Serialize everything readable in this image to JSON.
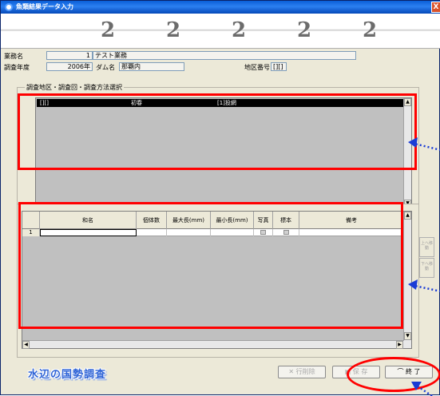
{
  "window": {
    "title": "魚類結果データ入力",
    "close_glyph": "X"
  },
  "binder": {
    "ring_glyph": "2"
  },
  "header": {
    "business_label": "業務名",
    "business_no": "1",
    "business_name": "テスト業務",
    "year_label": "調査年度",
    "year_value": "2006年",
    "dam_label": "ダム名",
    "dam_value": "那覇内",
    "area_label": "地区番号",
    "area_value": "[][]"
  },
  "survey_list": {
    "caption": "調査地区・調査回・調査方法選択",
    "selected_row": {
      "area": "[][]",
      "round": "初春",
      "method": "[1]投網"
    }
  },
  "grid": {
    "row_number": "1",
    "columns": [
      "和名",
      "個体数",
      "最大長(mm)",
      "最小長(mm)",
      "写真",
      "標本",
      "備考"
    ]
  },
  "side_buttons": {
    "move_up": "上へ移動",
    "move_down": "下へ移動"
  },
  "footer": {
    "logo_text": "水辺の国勢調査",
    "delete_label": "行削除",
    "delete_glyph": "✕",
    "save_label": "保 存",
    "save_glyph": "▣",
    "exit_label": "終 了",
    "exit_glyph": "⌒"
  },
  "colors": {
    "annotation_red": "#ff0000",
    "arrow_blue": "#1a3cd6",
    "logo_blue": "#2d62d6",
    "title_blue": "#0a5fd8"
  }
}
